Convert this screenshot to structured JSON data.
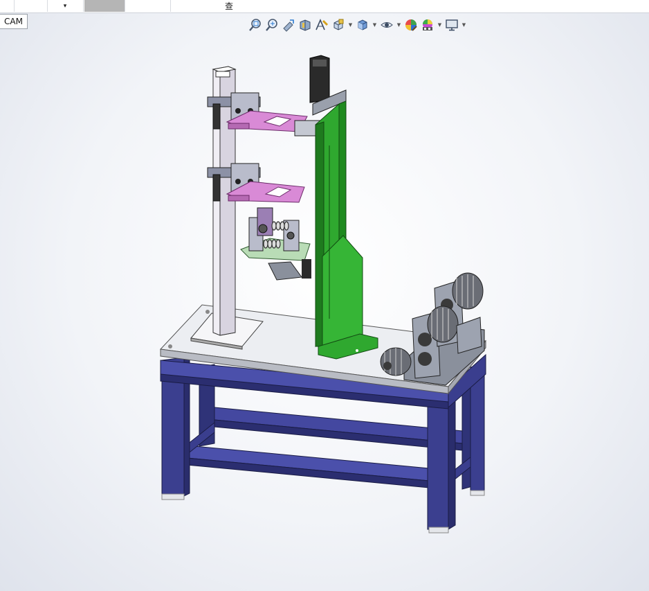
{
  "topbar": {
    "dropdown_arrow": "▾",
    "right_label": "查"
  },
  "view_tab": {
    "label": "CAM"
  },
  "toolbar": {
    "icons": [
      "zoom-to-fit-icon",
      "zoom-to-area-icon",
      "previous-view-icon",
      "section-view-icon",
      "dynamic-annotation-icon",
      "view-orientation-icon",
      "display-style-icon",
      "hide-show-items-icon",
      "edit-appearance-icon",
      "apply-scene-icon",
      "view-settings-icon"
    ]
  },
  "model": {
    "colors": {
      "frame": "#3b3f8f",
      "frame_light": "#5a5fb0",
      "green_column": "#2fa82f",
      "pink_arms": "#d98ad6",
      "gray_parts": "#8a909c",
      "plate": "#ecedf1"
    }
  }
}
